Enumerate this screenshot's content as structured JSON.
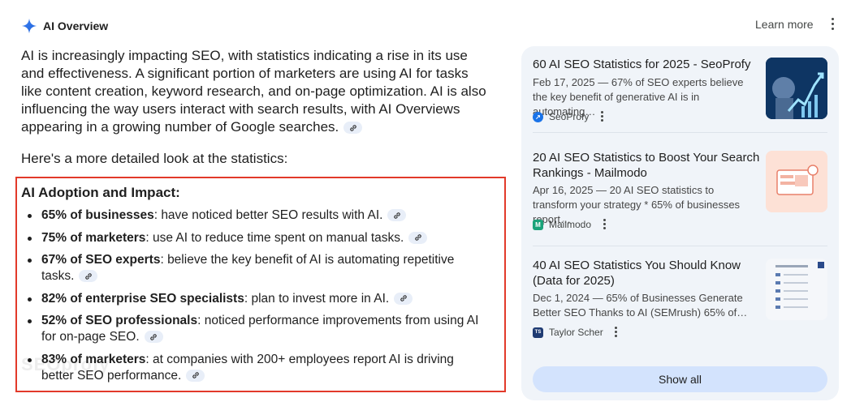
{
  "header": {
    "title": "AI Overview",
    "learn_more": "Learn more"
  },
  "summary": {
    "text": "AI is increasingly impacting SEO, with statistics indicating a rise in its use and effectiveness. A significant portion of marketers are using AI for tasks like content creation, keyword research, and on-page optimization. AI is also influencing the way users interact with search results, with AI Overviews appearing in a growing number of Google searches.",
    "detail_lead": "Here's a more detailed look at the statistics:"
  },
  "section": {
    "title": "AI Adoption and Impact:",
    "items": [
      {
        "bold": "65% of businesses",
        "rest": ": have noticed better SEO results with AI."
      },
      {
        "bold": "75% of marketers",
        "rest": ": use AI to reduce time spent on manual tasks."
      },
      {
        "bold": "67% of SEO experts",
        "rest": ": believe the key benefit of AI is automating repetitive tasks."
      },
      {
        "bold": "82% of enterprise SEO specialists",
        "rest": ": plan to invest more in AI."
      },
      {
        "bold": "52% of SEO professionals",
        "rest": ": noticed performance improvements from using AI for on-page SEO."
      },
      {
        "bold": "83% of marketers",
        "rest": ": at companies with 200+ employees report AI is driving better SEO performance."
      }
    ]
  },
  "watermark": "SEOprofy",
  "sources": [
    {
      "title": "60 AI SEO Statistics for 2025 - SeoProfy",
      "snippet": "Feb 17, 2025 — 67% of SEO experts believe the key benefit of generative AI is in automating…",
      "site": "SeoProfy",
      "favicon_icon": "seoprofy-arrow-icon",
      "favicon_color": "#1a73e8"
    },
    {
      "title": "20 AI SEO Statistics to Boost Your Search Rankings - Mailmodo",
      "snippet": "Apr 16, 2025 — 20 AI SEO statistics to transform your strategy * 65% of businesses report…",
      "site": "Mailmodo",
      "favicon_icon": "mailmodo-m-icon",
      "favicon_color": "#1aa37a"
    },
    {
      "title": "40 AI SEO Statistics You Should Know (Data for 2025)",
      "snippet": "Dec 1, 2024 — 65% of Businesses Generate Better SEO Thanks to AI (SEMrush) 65% of…",
      "site": "Taylor Scher",
      "favicon_icon": "ts-icon",
      "favicon_color": "#1f3b73"
    }
  ],
  "favicon_letters": [
    "↗",
    "M",
    "TS"
  ],
  "show_all": "Show all",
  "colors": {
    "accent": "#1a73e8",
    "highlight_border": "#e23a2a",
    "panel_bg": "#f0f4f9",
    "button_bg": "#d3e3fd"
  }
}
